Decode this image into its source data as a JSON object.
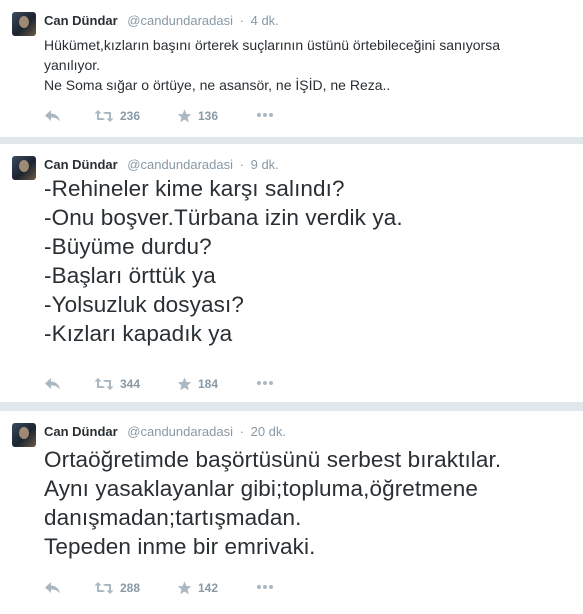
{
  "tweets": [
    {
      "name": "Can Dündar",
      "handle": "@candundaradasi",
      "separator": "·",
      "time": "4 dk.",
      "lines": [
        "Hükümet,kızların başını örterek suçlarının üstünü örtebileceğini sanıyorsa",
        "yanılıyor.",
        "Ne Soma sığar o örtüye, ne asansör, ne İŞİD, ne Reza.."
      ],
      "retweets": "236",
      "favorites": "136"
    },
    {
      "name": "Can Dündar",
      "handle": "@candundaradasi",
      "separator": "·",
      "time": "9 dk.",
      "lines": [
        "-Rehineler kime karşı salındı?",
        "-Onu boşver.Türbana izin verdik ya.",
        "-Büyüme durdu?",
        "-Başları örttük ya",
        "-Yolsuzluk dosyası?",
        "-Kızları kapadık ya"
      ],
      "retweets": "344",
      "favorites": "184"
    },
    {
      "name": "Can Dündar",
      "handle": "@candundaradasi",
      "separator": "·",
      "time": "20 dk.",
      "lines": [
        "Ortaöğretimde başörtüsünü serbest bıraktılar.",
        "Aynı yasaklayanlar gibi;topluma,öğretmene",
        "danışmadan;tartışmadan.",
        "Tepeden inme bir emrivaki."
      ],
      "retweets": "288",
      "favorites": "142"
    }
  ],
  "icons": {
    "reply": "reply-icon",
    "retweet": "retweet-icon",
    "favorite": "star-icon",
    "more": "more-icon"
  },
  "colors": {
    "background": "#e1e8ed",
    "card": "#ffffff",
    "text": "#292f33",
    "meta": "#8899a6",
    "icon": "#aab8c2"
  }
}
